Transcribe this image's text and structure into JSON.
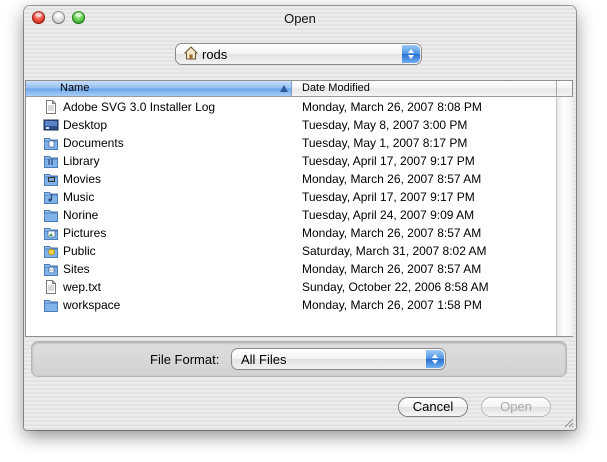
{
  "window": {
    "title": "Open"
  },
  "location": {
    "folder": "rods",
    "icon": "home-icon"
  },
  "columns": {
    "name": "Name",
    "date": "Date Modified"
  },
  "files": [
    {
      "name": "Adobe SVG 3.0 Installer Log",
      "date": "Monday, March 26, 2007 8:08 PM",
      "icon": "document-icon"
    },
    {
      "name": "Desktop",
      "date": "Tuesday, May 8, 2007 3:00 PM",
      "icon": "desktop-folder-icon"
    },
    {
      "name": "Documents",
      "date": "Tuesday, May 1, 2007 8:17 PM",
      "icon": "documents-folder-icon"
    },
    {
      "name": "Library",
      "date": "Tuesday, April 17, 2007 9:17 PM",
      "icon": "library-folder-icon"
    },
    {
      "name": "Movies",
      "date": "Monday, March 26, 2007 8:57 AM",
      "icon": "movies-folder-icon"
    },
    {
      "name": "Music",
      "date": "Tuesday, April 17, 2007 9:17 PM",
      "icon": "music-folder-icon"
    },
    {
      "name": "Norine",
      "date": "Tuesday, April 24, 2007 9:09 AM",
      "icon": "folder-icon"
    },
    {
      "name": "Pictures",
      "date": "Monday, March 26, 2007 8:57 AM",
      "icon": "pictures-folder-icon"
    },
    {
      "name": "Public",
      "date": "Saturday, March 31, 2007 8:02 AM",
      "icon": "public-folder-icon"
    },
    {
      "name": "Sites",
      "date": "Monday, March 26, 2007 8:57 AM",
      "icon": "sites-folder-icon"
    },
    {
      "name": "wep.txt",
      "date": "Sunday, October 22, 2006 8:58 AM",
      "icon": "text-file-icon"
    },
    {
      "name": "workspace",
      "date": "Monday, March 26, 2007 1:58 PM",
      "icon": "folder-icon"
    }
  ],
  "format": {
    "label": "File Format:",
    "value": "All Files"
  },
  "buttons": {
    "cancel": "Cancel",
    "open": "Open"
  },
  "colors": {
    "header_selected": "#8fbdf1",
    "popup_arrows": "#4b93e6",
    "folder": "#7fb3ea"
  }
}
